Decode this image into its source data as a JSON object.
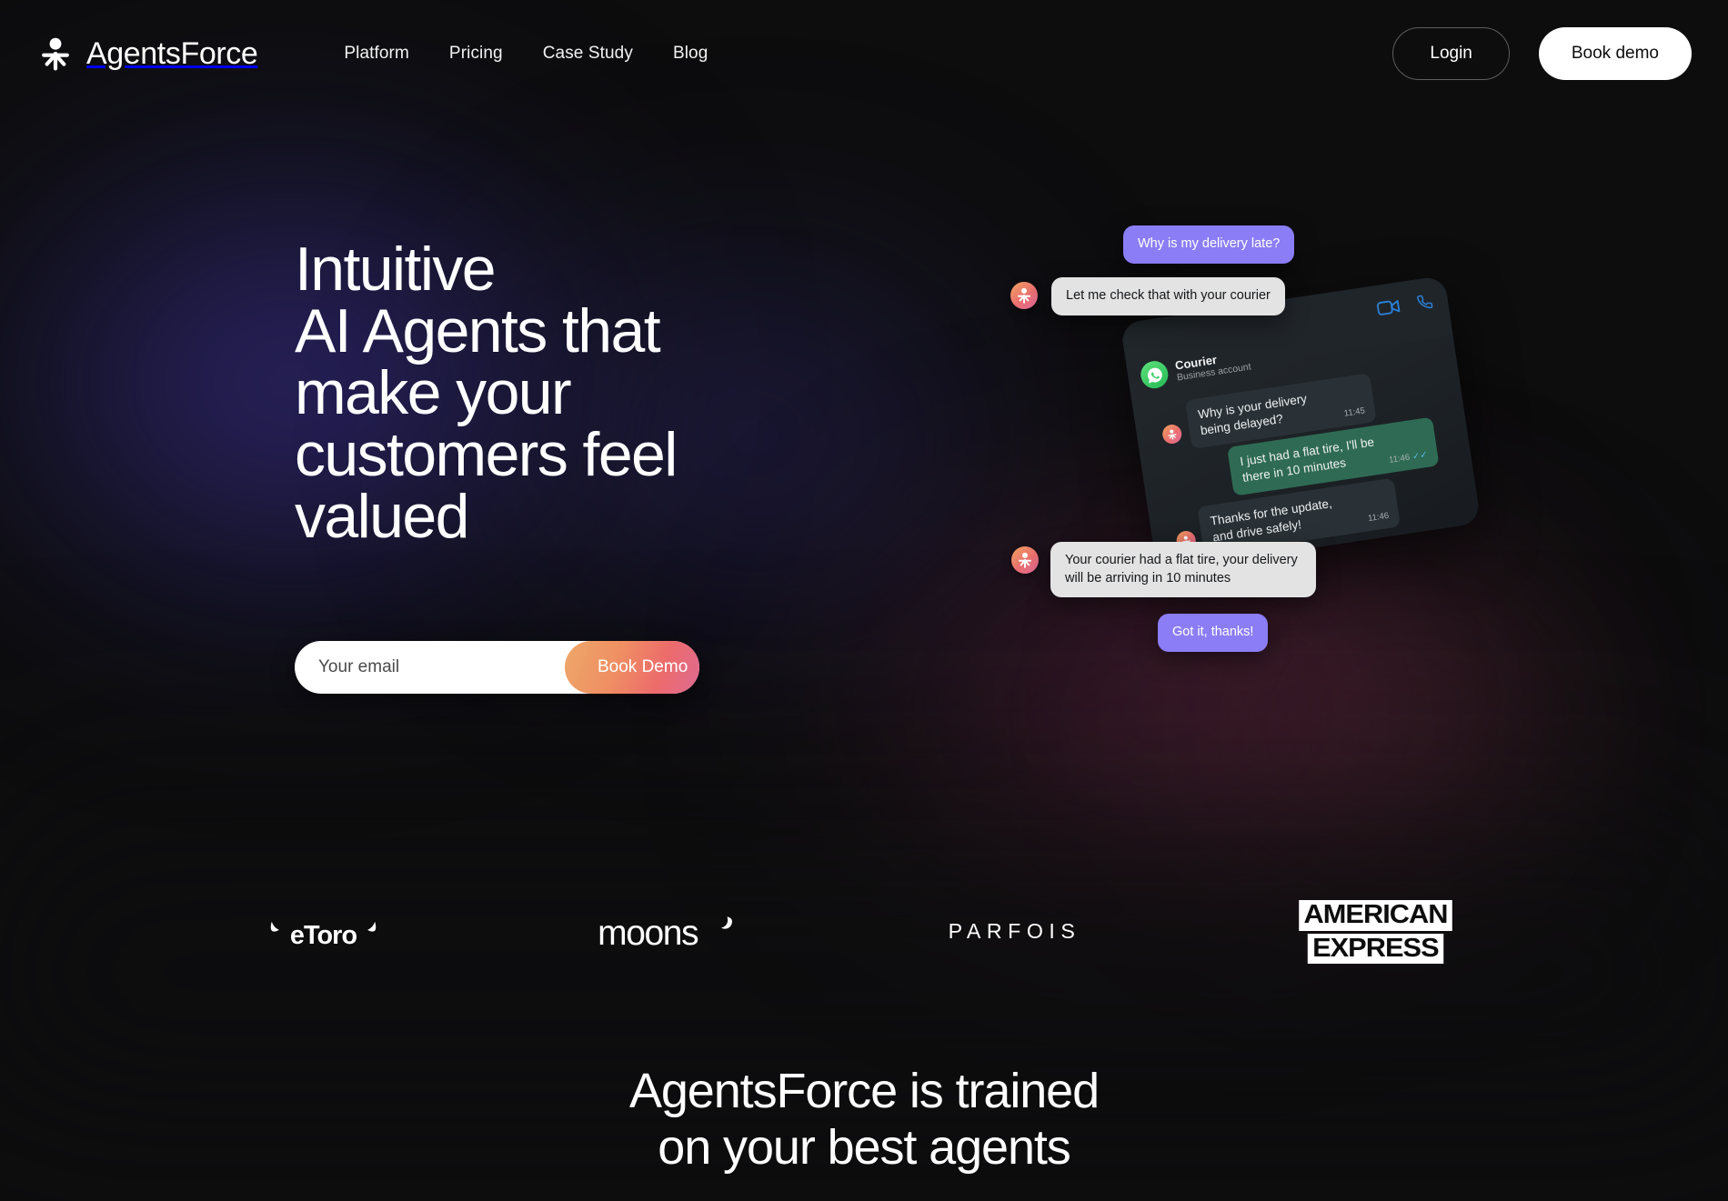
{
  "brand": {
    "name": "AgentsForce",
    "logo_icon": "person-asterisk-icon"
  },
  "nav": {
    "items": [
      {
        "label": "Platform"
      },
      {
        "label": "Pricing"
      },
      {
        "label": "Case Study"
      },
      {
        "label": "Blog"
      }
    ],
    "login_label": "Login",
    "book_demo_label": "Book demo"
  },
  "hero": {
    "heading": "Intuitive\nAI Agents that\nmake your\ncustomers feel\nvalued",
    "email_placeholder": "Your email",
    "email_value": "",
    "submit_label": "Book Demo"
  },
  "chat": {
    "overlay_messages": [
      {
        "id": "fb-1",
        "text": "Why is my delivery late?",
        "sender": "user"
      },
      {
        "id": "fb-2",
        "text": "Let me check that with your courier",
        "sender": "agent"
      },
      {
        "id": "fb-3",
        "text": "Your courier had a flat tire, your delivery will be arriving in 10 minutes",
        "sender": "agent"
      },
      {
        "id": "fb-4",
        "text": "Got it, thanks!",
        "sender": "user"
      }
    ],
    "whatsapp": {
      "contact_name": "Courier",
      "contact_subtitle": "Business account",
      "app_icon": "whatsapp-icon",
      "video_icon": "video-call-icon",
      "phone_icon": "phone-call-icon",
      "messages": [
        {
          "text": "Why is your delivery being delayed?",
          "time": "11:45",
          "direction": "in",
          "read": false
        },
        {
          "text": "I just had a flat tire, I'll be there in 10 minutes",
          "time": "11:46",
          "direction": "out",
          "read": true
        },
        {
          "text": "Thanks for the update, and drive safely!",
          "time": "11:46",
          "direction": "in",
          "read": false
        }
      ]
    }
  },
  "clients": {
    "logos": [
      {
        "name": "eToro"
      },
      {
        "name": "moons"
      },
      {
        "name": "PARFOIS"
      },
      {
        "name": "AMERICAN EXPRESS",
        "line1": "AMERICAN",
        "line2": "EXPRESS"
      }
    ]
  },
  "section": {
    "heading": "AgentsForce is trained\non your best agents"
  },
  "colors": {
    "page_background": "#0d0d0e",
    "accent_purple": "#8b7df5",
    "accent_gradient_start": "#eea86a",
    "accent_gradient_end": "#d86aa4",
    "whatsapp_green": "#22ba55",
    "outgoing_bubble": "#2f6b54",
    "incoming_bubble": "#2a3136",
    "tick_blue": "#53bdeb"
  }
}
